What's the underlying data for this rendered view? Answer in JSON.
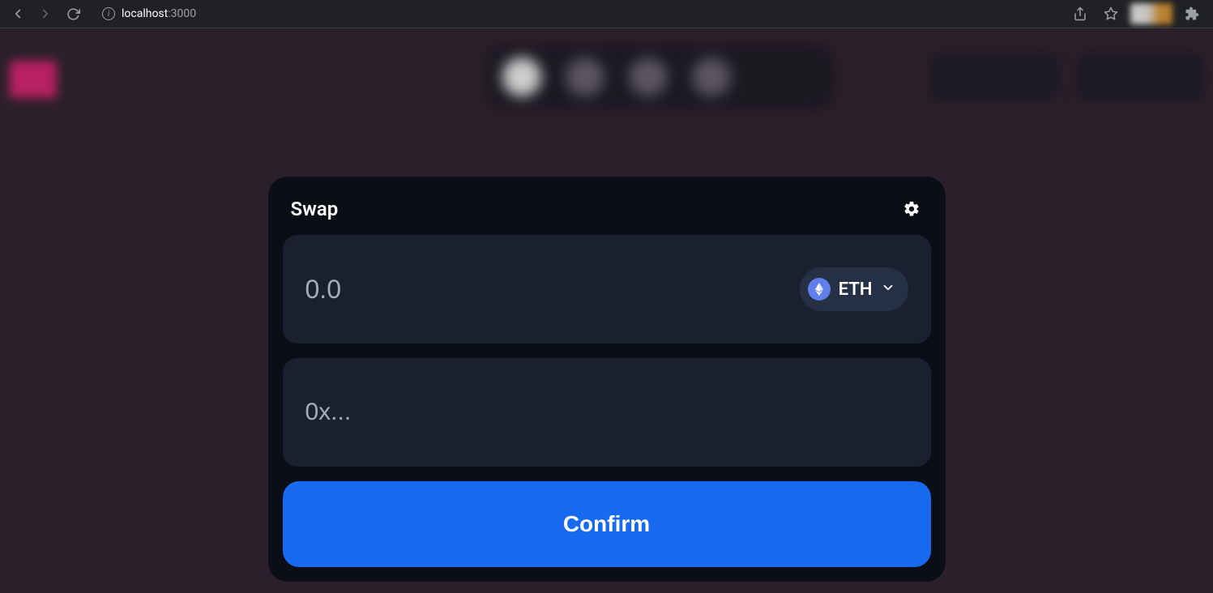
{
  "browser": {
    "url_host": "localhost",
    "url_port": ":3000"
  },
  "swap": {
    "title": "Swap",
    "amount_placeholder": "0.0",
    "amount_value": "",
    "address_placeholder": "0x...",
    "address_value": "",
    "token": {
      "symbol": "ETH",
      "icon_name": "ethereum-icon",
      "icon_color": "#627eea"
    },
    "confirm_label": "Confirm"
  }
}
